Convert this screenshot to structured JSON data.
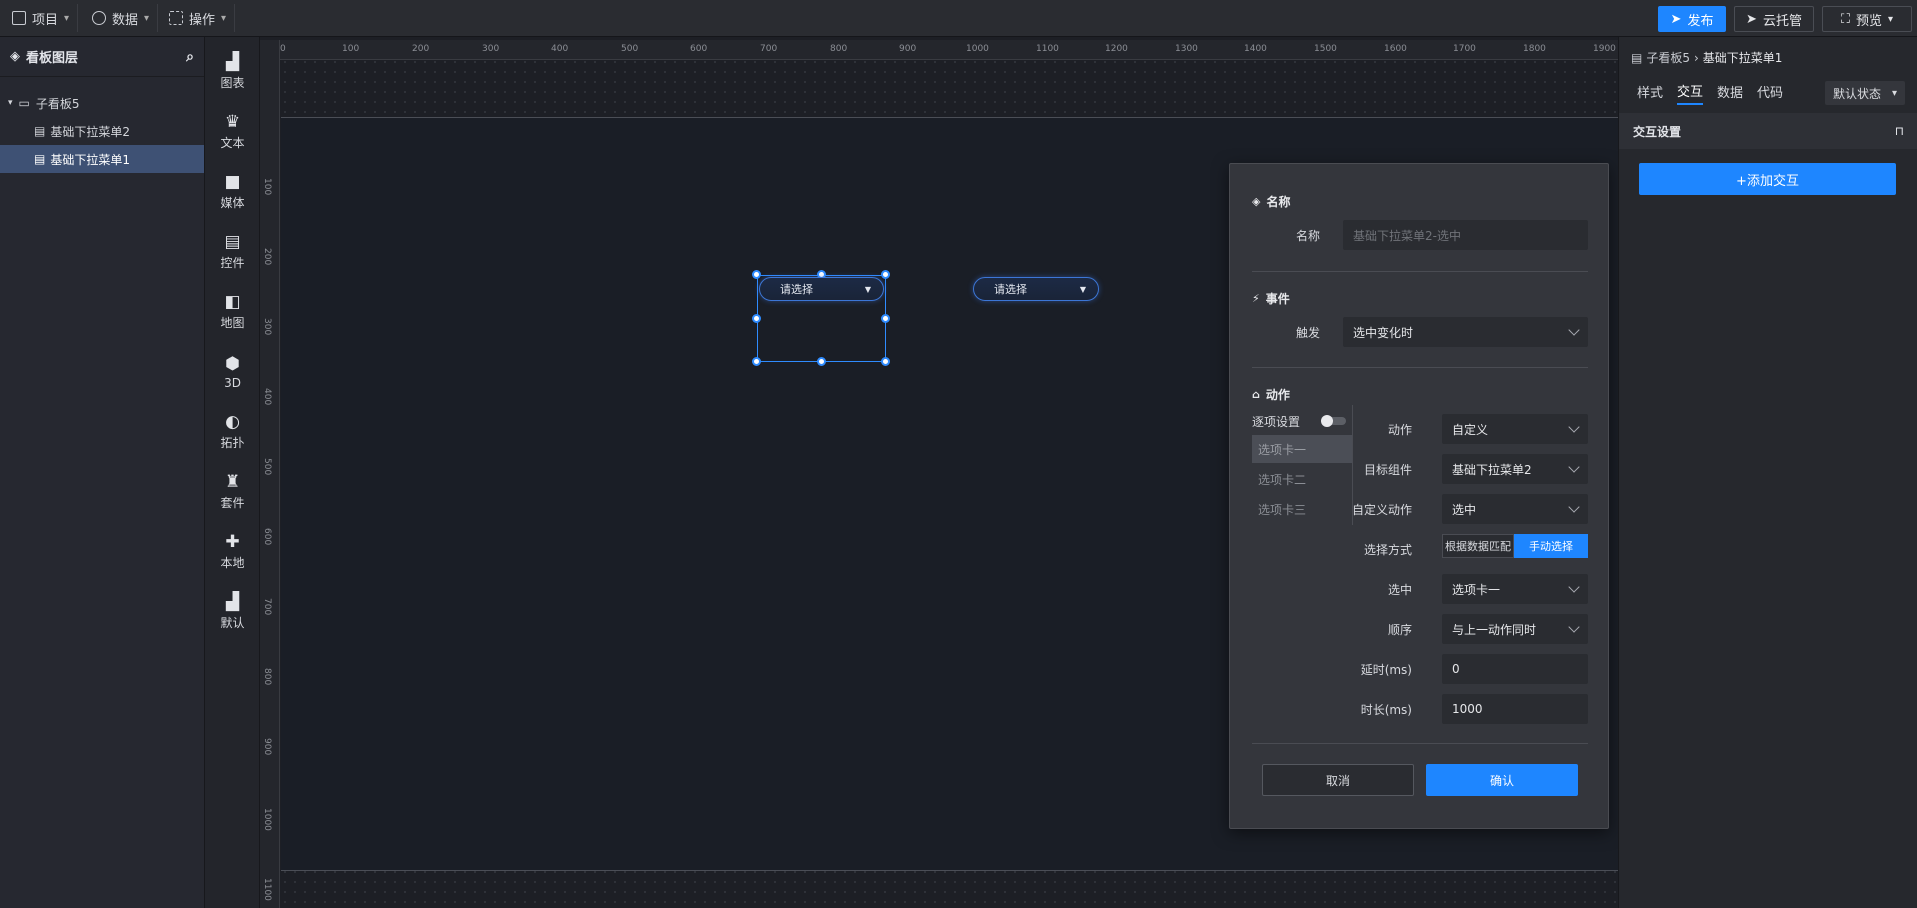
{
  "topbar": {
    "menus": [
      {
        "label": "项目",
        "icon": "file-icon"
      },
      {
        "label": "数据",
        "icon": "database-icon"
      },
      {
        "label": "操作",
        "icon": "grid-icon"
      }
    ],
    "publish_label": "发布",
    "cloud_label": "云托管",
    "preview_label": "预览"
  },
  "layers": {
    "title": "看板图层",
    "root": "子看板5",
    "items": [
      "基础下拉菜单2",
      "基础下拉菜单1"
    ]
  },
  "tools": [
    "图表",
    "文本",
    "媒体",
    "控件",
    "地图",
    "3D",
    "拓扑",
    "套件",
    "本地",
    "默认"
  ],
  "ruler": {
    "top": [
      "0",
      "100",
      "200",
      "300",
      "400",
      "500",
      "600",
      "700",
      "800",
      "900",
      "1000",
      "1100",
      "1200",
      "1300",
      "1400",
      "1500",
      "1600",
      "1700",
      "1800",
      "1900"
    ],
    "left": [
      "100",
      "200",
      "300",
      "400",
      "500",
      "600",
      "700",
      "800",
      "900",
      "1000",
      "1100"
    ]
  },
  "canvas": {
    "dropdown1_text": "请选择",
    "dropdown2_text": "请选择"
  },
  "dialog": {
    "name_section": "名称",
    "name_label": "名称",
    "name_placeholder": "基础下拉菜单2-选中",
    "event_section": "事件",
    "trigger_label": "触发",
    "trigger_value": "选中变化时",
    "action_section": "动作",
    "per_item_label": "逐项设置",
    "tabs": [
      "选项卡一",
      "选项卡二",
      "选项卡三"
    ],
    "action_label": "动作",
    "action_value": "自定义",
    "target_label": "目标组件",
    "target_value": "基础下拉菜单2",
    "custom_action_label": "自定义动作",
    "custom_action_value": "选中",
    "select_mode_label": "选择方式",
    "select_mode_options": [
      "根据数据匹配",
      "手动选择"
    ],
    "selected_label": "选中",
    "selected_value": "选项卡一",
    "order_label": "顺序",
    "order_value": "与上一动作同时",
    "delay_label": "延时(ms)",
    "delay_value": "0",
    "duration_label": "时长(ms)",
    "duration_value": "1000",
    "cancel_label": "取消",
    "confirm_label": "确认"
  },
  "rightpanel": {
    "breadcrumb_parent": "子看板5",
    "breadcrumb_current": "基础下拉菜单1",
    "tabs": [
      "样式",
      "交互",
      "数据",
      "代码"
    ],
    "state_value": "默认状态",
    "section_title": "交互设置",
    "add_label": "+添加交互"
  },
  "colors": {
    "accent": "#1e86ff",
    "selection": "#2f8cff"
  }
}
